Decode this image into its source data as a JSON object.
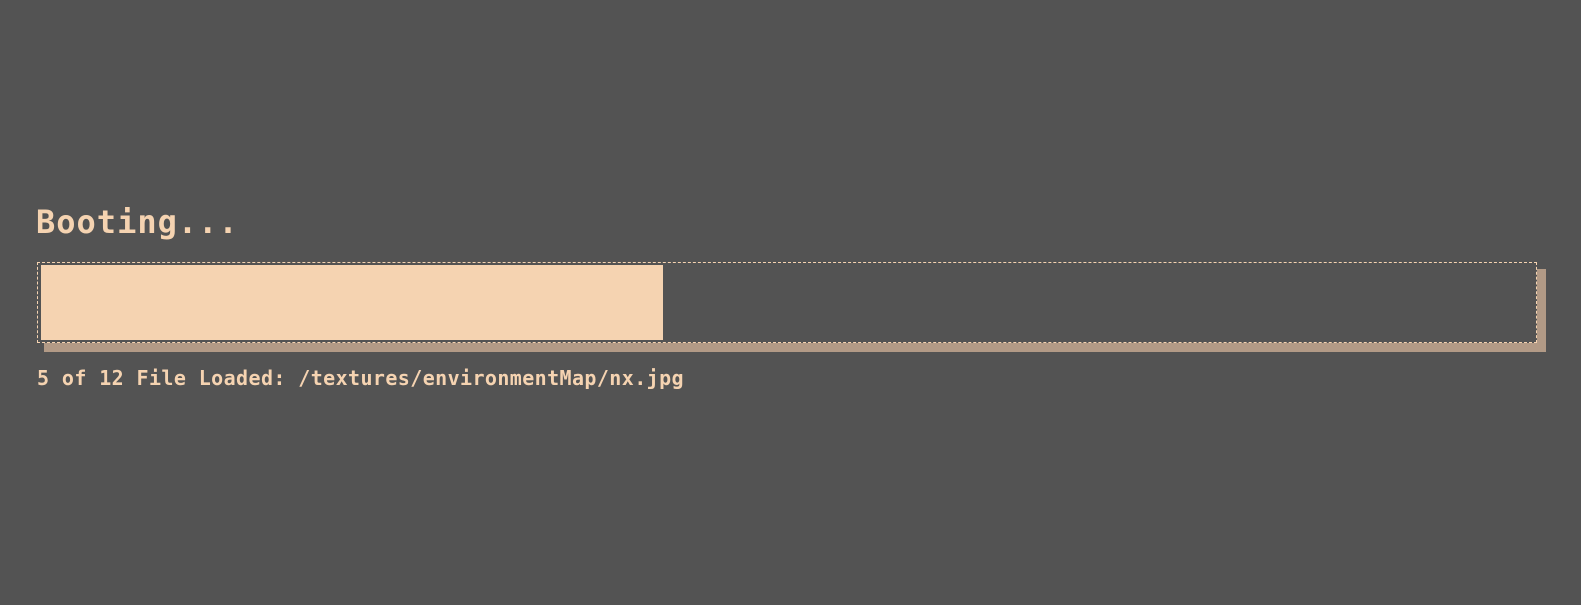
{
  "loader": {
    "title": "Booting...",
    "progress": {
      "loaded": 5,
      "total": 12,
      "fraction": 0.4167
    },
    "status": {
      "count_text": "5 of 12 File Loaded:",
      "file_path": "/textures/environmentMap/nx.jpg"
    }
  },
  "colors": {
    "background": "#535353",
    "accent": "#f5d3b1",
    "shadow": "#b29a86"
  }
}
